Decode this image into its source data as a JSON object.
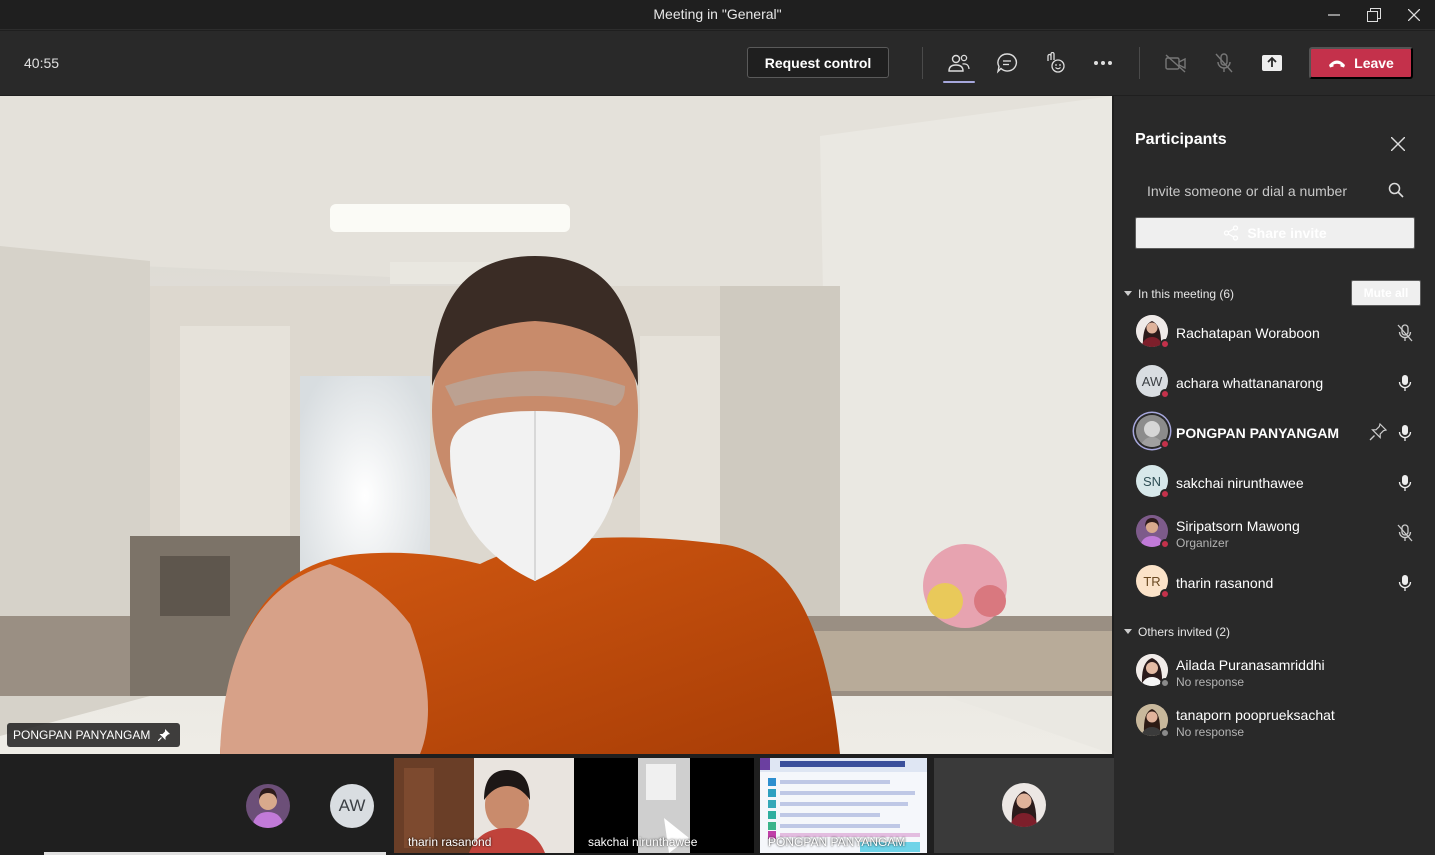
{
  "window": {
    "title": "Meeting in \"General\""
  },
  "toolbar": {
    "timer": "40:55",
    "request_control_label": "Request control",
    "leave_label": "Leave",
    "colors": {
      "leave": "#c4314b",
      "active_underline": "#a6a7dc"
    }
  },
  "stage": {
    "speaker_name": "PONGPAN PANYANGAM"
  },
  "filmstrip": {
    "thumbs": [
      {
        "label": "tharin rasanond"
      },
      {
        "label": "sakchai nirunthawee"
      },
      {
        "label": "PONGPAN PANYANGAM"
      }
    ],
    "avatar_initials": "AW"
  },
  "panel": {
    "title": "Participants",
    "search_placeholder": "Invite someone or dial a number",
    "share_invite_label": "Share invite",
    "in_meeting_header": "In this meeting (6)",
    "mute_all_label": "Mute all",
    "others_header": "Others invited (2)",
    "in_meeting": [
      {
        "name": "Rachatapan Woraboon",
        "initials": "",
        "mic": "muted"
      },
      {
        "name": "achara whattananarong",
        "initials": "AW",
        "mic": "on"
      },
      {
        "name": "PONGPAN PANYANGAM",
        "initials": "",
        "mic": "on",
        "pinned": true
      },
      {
        "name": "sakchai nirunthawee",
        "initials": "SN",
        "mic": "on"
      },
      {
        "name": "Siripatsorn Mawong",
        "role": "Organizer",
        "initials": "",
        "mic": "muted"
      },
      {
        "name": "tharin rasanond",
        "initials": "TR",
        "mic": "on"
      }
    ],
    "others": [
      {
        "name": "Ailada Puranasamriddhi",
        "status": "No response"
      },
      {
        "name": "tanaporn pooprueksachat",
        "status": "No response"
      }
    ]
  }
}
